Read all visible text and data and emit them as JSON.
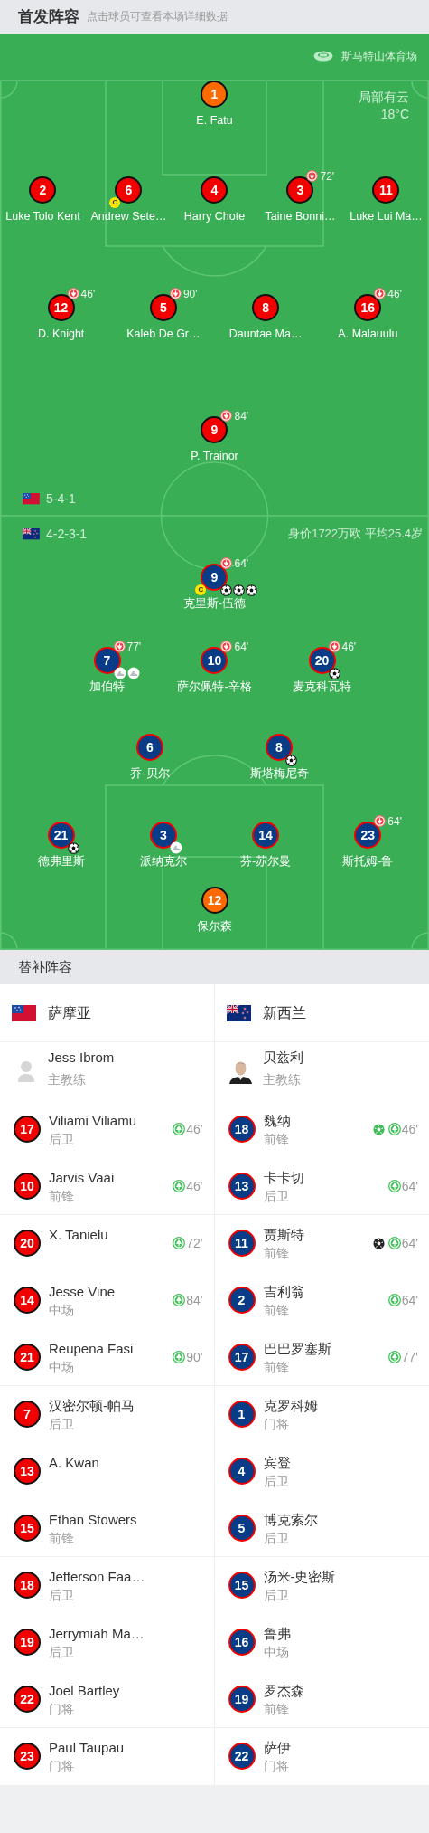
{
  "header": {
    "title": "首发阵容",
    "hint": "点击球员可查看本场详细数据"
  },
  "pitch": {
    "stadium": "斯马特山体育场",
    "weather": "局部有云",
    "temperature": "18°C",
    "value": "身价1722万欧 平均25.4岁",
    "teams": [
      {
        "kind": "samoa",
        "formation": "5-4-1",
        "lines": [
          [
            {
              "number": "1",
              "name": "E. Fatu",
              "keeper": true
            }
          ],
          [
            {
              "number": "2",
              "name": "Luke Tolo Kent",
              "keeper": false
            },
            {
              "number": "6",
              "name": "Andrew Sete…",
              "keeper": false,
              "captain_badge": "C"
            },
            {
              "number": "4",
              "name": "Harry Chote",
              "keeper": false
            },
            {
              "number": "3",
              "name": "Taine Bonni…",
              "keeper": false,
              "sub_off": "72'"
            },
            {
              "number": "11",
              "name": "Luke Lui Ma…",
              "keeper": false
            }
          ],
          [
            {
              "number": "12",
              "name": "D. Knight",
              "keeper": false,
              "sub_off": "46'"
            },
            {
              "number": "5",
              "name": "Kaleb De Gr…",
              "keeper": false,
              "sub_off": "90'"
            },
            {
              "number": "8",
              "name": "Dauntae Ma…",
              "keeper": false
            },
            {
              "number": "16",
              "name": "A. Malauulu",
              "keeper": false,
              "sub_off": "46'"
            }
          ],
          [
            {
              "number": "9",
              "name": "P. Trainor",
              "keeper": false,
              "sub_off": "84'"
            }
          ]
        ]
      },
      {
        "kind": "new_zealand",
        "formation": "4-2-3-1",
        "lines": [
          [
            {
              "number": "9",
              "name": "克里斯-伍德",
              "keeper": false,
              "captain_badge": "C",
              "sub_off": "64'",
              "events": [
                {
                  "kind": "goal"
                },
                {
                  "kind": "goal"
                },
                {
                  "kind": "goal"
                }
              ]
            }
          ],
          [
            {
              "number": "7",
              "name": "加伯特",
              "keeper": false,
              "sub_off": "77'",
              "events": [
                {
                  "kind": "assist"
                },
                {
                  "kind": "assist"
                }
              ]
            },
            {
              "number": "10",
              "name": "萨尔佩特-辛格",
              "keeper": false,
              "sub_off": "64'"
            },
            {
              "number": "20",
              "name": "麦克科瓦特",
              "keeper": false,
              "sub_off": "46'",
              "events": [
                {
                  "kind": "goal"
                }
              ]
            }
          ],
          [
            {
              "number": "6",
              "name": "乔-贝尔",
              "keeper": false
            },
            {
              "number": "8",
              "name": "斯塔梅尼奇",
              "keeper": false,
              "events": [
                {
                  "kind": "goal"
                }
              ]
            }
          ],
          [
            {
              "number": "21",
              "name": "德弗里斯",
              "keeper": false,
              "events": [
                {
                  "kind": "goal"
                }
              ]
            },
            {
              "number": "3",
              "name": "派纳克尔",
              "keeper": false,
              "events": [
                {
                  "kind": "assist"
                }
              ]
            },
            {
              "number": "14",
              "name": "芬-苏尔曼",
              "keeper": false
            },
            {
              "number": "23",
              "name": "斯托姆-鲁",
              "keeper": false,
              "sub_off": "64'"
            }
          ],
          [
            {
              "number": "12",
              "name": "保尔森",
              "keeper": true
            }
          ]
        ]
      }
    ]
  },
  "substitutes": {
    "title": "替补阵容",
    "teams": [
      {
        "kind": "samoa",
        "name": "萨摩亚",
        "coach": {
          "kind": "placeholder",
          "name": "Jess Ibrom",
          "role": "主教练"
        },
        "players": [
          {
            "number": "17",
            "name": "Viliami Viliamu",
            "position": "后卫",
            "events": [
              {
                "kind": "sub_on",
                "minute": "46'"
              }
            ]
          },
          {
            "number": "10",
            "name": "Jarvis Vaai",
            "position": "前锋",
            "events": [
              {
                "kind": "sub_on",
                "minute": "46'"
              }
            ]
          },
          {
            "number": "20",
            "name": "X. Tanielu",
            "events": [
              {
                "kind": "sub_on",
                "minute": "72'"
              }
            ]
          },
          {
            "number": "14",
            "name": "Jesse Vine",
            "position": "中场",
            "events": [
              {
                "kind": "sub_on",
                "minute": "84'"
              }
            ]
          },
          {
            "number": "21",
            "name": "Reupena Fasi",
            "position": "中场",
            "events": [
              {
                "kind": "sub_on",
                "minute": "90'"
              }
            ]
          },
          {
            "number": "7",
            "name": "汉密尔顿-帕马",
            "position": "后卫"
          },
          {
            "number": "13",
            "name": "A. Kwan"
          },
          {
            "number": "15",
            "name": "Ethan Stowers",
            "position": "前锋"
          },
          {
            "number": "18",
            "name": "Jefferson Faa…",
            "position": "后卫"
          },
          {
            "number": "19",
            "name": "Jerrymiah Ma…",
            "position": "后卫"
          },
          {
            "number": "22",
            "name": "Joel Bartley",
            "position": "门将"
          },
          {
            "number": "23",
            "name": "Paul Taupau",
            "position": "门将"
          }
        ]
      },
      {
        "kind": "new_zealand",
        "name": "新西兰",
        "coach": {
          "name": "贝兹利",
          "role": "主教练"
        },
        "players": [
          {
            "number": "18",
            "name": "魏纳",
            "position": "前锋",
            "events": [
              {
                "kind": "goal",
                "color": "#3dbb55"
              },
              {
                "kind": "sub_on",
                "minute": "46'"
              }
            ]
          },
          {
            "number": "13",
            "name": "卡卡切",
            "position": "后卫",
            "events": [
              {
                "kind": "sub_on",
                "minute": "64'"
              }
            ]
          },
          {
            "number": "11",
            "name": "贾斯特",
            "position": "前锋",
            "events": [
              {
                "kind": "goal",
                "color": "#222222"
              },
              {
                "kind": "sub_on",
                "minute": "64'"
              }
            ]
          },
          {
            "number": "2",
            "name": "吉利翁",
            "position": "前锋",
            "events": [
              {
                "kind": "sub_on",
                "minute": "64'"
              }
            ]
          },
          {
            "number": "17",
            "name": "巴巴罗塞斯",
            "position": "前锋",
            "events": [
              {
                "kind": "sub_on",
                "minute": "77'"
              }
            ]
          },
          {
            "number": "1",
            "name": "克罗科姆",
            "position": "门将"
          },
          {
            "number": "4",
            "name": "宾登",
            "position": "后卫"
          },
          {
            "number": "5",
            "name": "博克索尔",
            "position": "后卫"
          },
          {
            "number": "15",
            "name": "汤米-史密斯",
            "position": "后卫"
          },
          {
            "number": "16",
            "name": "鲁弗",
            "position": "中场"
          },
          {
            "number": "19",
            "name": "罗杰森",
            "position": "前锋"
          },
          {
            "number": "22",
            "name": "萨伊",
            "position": "门将"
          }
        ]
      }
    ]
  }
}
